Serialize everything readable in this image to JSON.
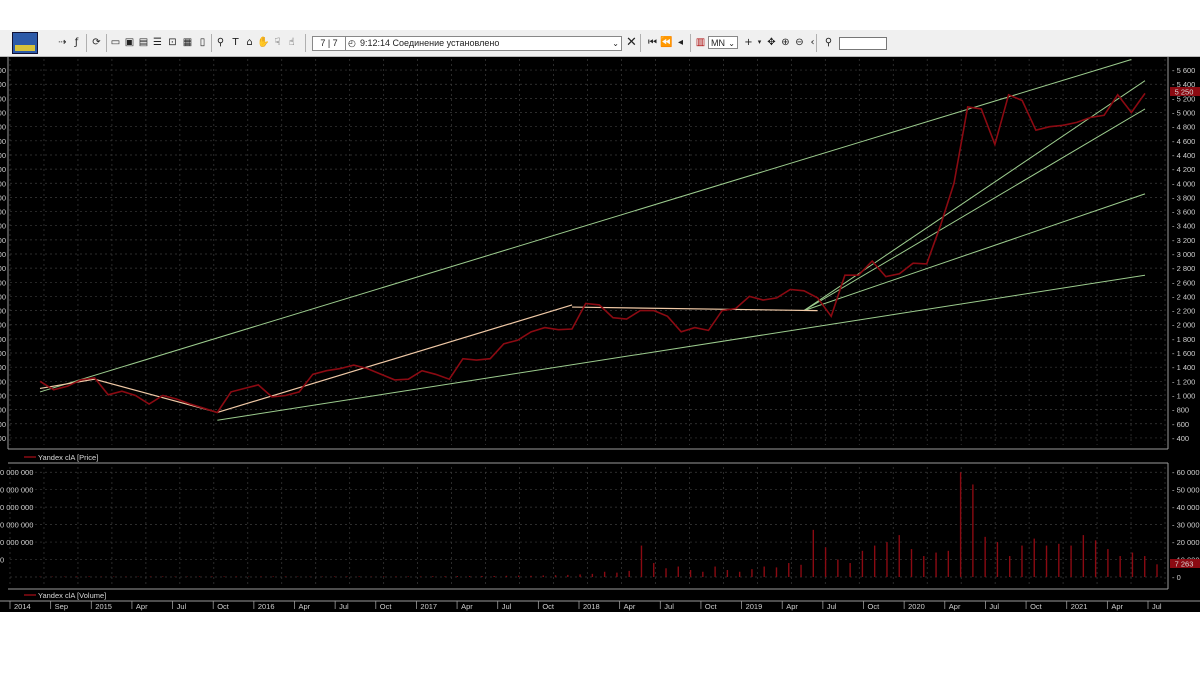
{
  "toolbar": {
    "counter": "7 | 7",
    "time": "9:12:14",
    "status": "Соединение установлено",
    "period": "MN",
    "search_value": ""
  },
  "colors": {
    "background": "#000000",
    "price_line": "#8b0a12",
    "trend_lines": "#9ccc8e",
    "swing_lines": "#f0c9a6",
    "grid": "#3c3c3c",
    "volume_bars": "#8b0a12"
  },
  "chart_data": {
    "type": "line",
    "price_panel": {
      "legend": "Yandex clA [Price]",
      "y_ticks": [
        "5 600",
        "5 400",
        "5 200",
        "5 000",
        "4 800",
        "4 600",
        "4 400",
        "4 200",
        "4 000",
        "3 800",
        "3 600",
        "3 400",
        "3 200",
        "3 000",
        "2 800",
        "2 600",
        "2 400",
        "2 200",
        "2 000",
        "1 800",
        "1 600",
        "1 400",
        "1 200",
        "1 000",
        "800",
        "600",
        "400"
      ],
      "ylim": [
        300,
        5700
      ],
      "last_value_badge": "5 250",
      "series": [
        {
          "values": [
            1200,
            1080,
            1130,
            1220,
            1250,
            1010,
            1060,
            1000,
            880,
            1000,
            950,
            880,
            820,
            760,
            1050,
            1100,
            1150,
            980,
            1000,
            1050,
            1300,
            1350,
            1380,
            1430,
            1380,
            1300,
            1220,
            1230,
            1350,
            1300,
            1230,
            1520,
            1500,
            1520,
            1730,
            1780,
            1900,
            1960,
            1930,
            1940,
            2300,
            2280,
            2100,
            2080,
            2200,
            2200,
            2120,
            1900,
            1960,
            1920,
            2200,
            2230,
            2400,
            2350,
            2380,
            2500,
            2480,
            2380,
            2120,
            2700,
            2700,
            2900,
            2680,
            2720,
            2870,
            2860,
            3400,
            4000,
            5080,
            5050,
            4550,
            5250,
            5170,
            4750,
            4800,
            4820,
            4860,
            4930,
            4960,
            5250,
            5000,
            5270
          ]
        }
      ],
      "trend_lines": [
        {
          "from": [
            0,
            1050
          ],
          "to": [
            80,
            5750
          ]
        },
        {
          "from": [
            13,
            650
          ],
          "to": [
            81,
            2700
          ]
        },
        {
          "from": [
            56,
            2200
          ],
          "to": [
            81,
            3850
          ]
        },
        {
          "from": [
            56,
            2200
          ],
          "to": [
            81,
            5050
          ]
        },
        {
          "from": [
            56,
            2200
          ],
          "to": [
            81,
            5450
          ]
        }
      ],
      "swing_lines": [
        {
          "from": [
            0,
            1100
          ],
          "to": [
            4,
            1230
          ]
        },
        {
          "from": [
            4,
            1230
          ],
          "to": [
            13,
            760
          ]
        },
        {
          "from": [
            13,
            760
          ],
          "to": [
            39,
            2280
          ]
        },
        {
          "from": [
            39,
            2250
          ],
          "to": [
            57,
            2200
          ]
        }
      ]
    },
    "volume_panel": {
      "legend": "Yandex clA [Volume]",
      "y_ticks_left": [
        "0 000 000",
        "0 000 000",
        "0 000 000",
        "0 000 000",
        "0 000 000",
        "0"
      ],
      "y_ticks_right": [
        "60 000",
        "50 000",
        "40 000",
        "30 000",
        "20 000",
        "10 000",
        "0"
      ],
      "ylim": [
        0,
        63000
      ],
      "last_value_badge": "7 263",
      "values": [
        200,
        200,
        200,
        300,
        300,
        200,
        200,
        200,
        200,
        300,
        300,
        200,
        200,
        300,
        300,
        300,
        300,
        200,
        300,
        300,
        300,
        200,
        200,
        200,
        300,
        300,
        300,
        200,
        300,
        300,
        300,
        300,
        400,
        400,
        500,
        500,
        600,
        600,
        700,
        800,
        700,
        900,
        1000,
        1200,
        1500,
        1800,
        3000,
        2500,
        3500,
        18000,
        8000,
        5000,
        6000,
        4000,
        3000,
        6000,
        4000,
        3000,
        4500,
        6000,
        5500,
        8000,
        7000,
        27000,
        17000,
        10000,
        8000,
        15000,
        18000,
        20000,
        24000,
        16000,
        12000,
        14000,
        15000,
        60000,
        53000,
        23000,
        20000,
        12000,
        18000,
        22000,
        18000,
        19000,
        18000,
        24000,
        21000,
        16000,
        12000,
        14000,
        12000,
        7263
      ]
    },
    "x_axis": {
      "labels": [
        "2014",
        "Sep",
        "2015",
        "Apr",
        "Jul",
        "Oct",
        "2016",
        "Apr",
        "Jul",
        "Oct",
        "2017",
        "Apr",
        "Jul",
        "Oct",
        "2018",
        "Apr",
        "Jul",
        "Oct",
        "2019",
        "Apr",
        "Jul",
        "Oct",
        "2020",
        "Apr",
        "Jul",
        "Oct",
        "2021",
        "Apr",
        "Jul"
      ]
    }
  }
}
